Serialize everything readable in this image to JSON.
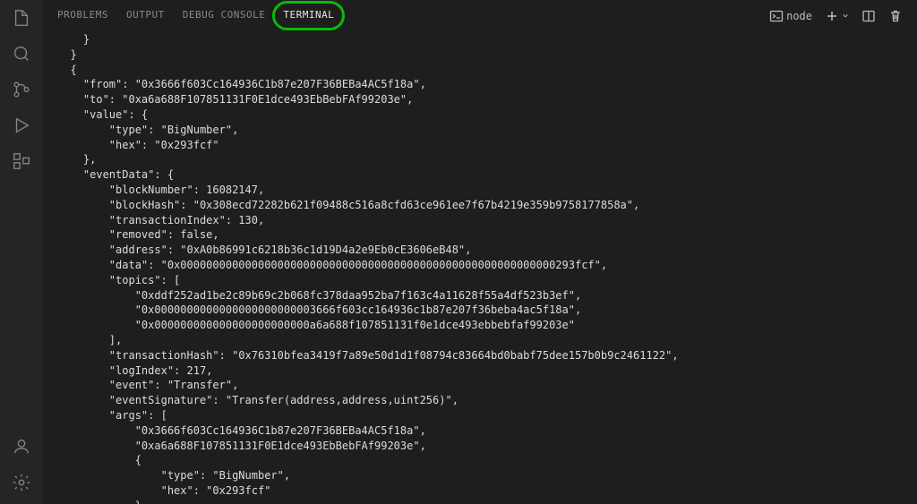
{
  "tabs": {
    "problems": "PROBLEMS",
    "output": "OUTPUT",
    "debugConsole": "DEBUG CONSOLE",
    "terminal": "TERMINAL"
  },
  "panelActions": {
    "shellLabel": "node"
  },
  "terminalOutput": "    }\n  }\n  {\n    \"from\": \"0x3666f603Cc164936C1b87e207F36BEBa4AC5f18a\",\n    \"to\": \"0xa6a688F107851131F0E1dce493EbBebFAf99203e\",\n    \"value\": {\n        \"type\": \"BigNumber\",\n        \"hex\": \"0x293fcf\"\n    },\n    \"eventData\": {\n        \"blockNumber\": 16082147,\n        \"blockHash\": \"0x308ecd72282b621f09488c516a8cfd63ce961ee7f67b4219e359b9758177858a\",\n        \"transactionIndex\": 130,\n        \"removed\": false,\n        \"address\": \"0xA0b86991c6218b36c1d19D4a2e9Eb0cE3606eB48\",\n        \"data\": \"0x0000000000000000000000000000000000000000000000000000000000293fcf\",\n        \"topics\": [\n            \"0xddf252ad1be2c89b69c2b068fc378daa952ba7f163c4a11628f55a4df523b3ef\",\n            \"0x0000000000000000000000003666f603cc164936c1b87e207f36beba4ac5f18a\",\n            \"0x000000000000000000000000a6a688f107851131f0e1dce493ebbebfaf99203e\"\n        ],\n        \"transactionHash\": \"0x76310bfea3419f7a89e50d1d1f08794c83664bd0babf75dee157b0b9c2461122\",\n        \"logIndex\": 217,\n        \"event\": \"Transfer\",\n        \"eventSignature\": \"Transfer(address,address,uint256)\",\n        \"args\": [\n            \"0x3666f603Cc164936C1b87e207F36BEBa4AC5f18a\",\n            \"0xa6a688F107851131F0E1dce493EbBebFAf99203e\",\n            {\n                \"type\": \"BigNumber\",\n                \"hex\": \"0x293fcf\"\n            }\n        ]\n    }\n  }"
}
